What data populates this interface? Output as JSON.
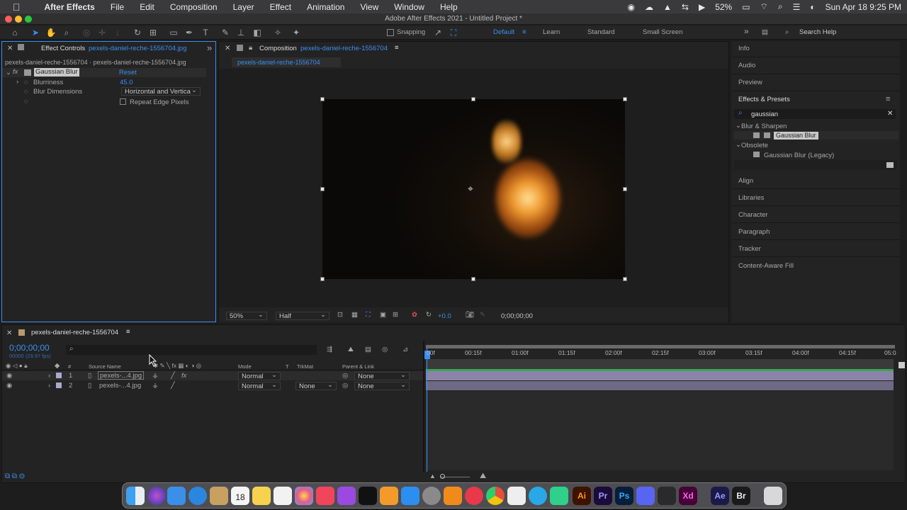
{
  "menubar": {
    "app": "After Effects",
    "items": [
      "File",
      "Edit",
      "Composition",
      "Layer",
      "Effect",
      "Animation",
      "View",
      "Window",
      "Help"
    ],
    "battery": "52%",
    "datetime": "Sun Apr 18  9:25 PM"
  },
  "window": {
    "title": "Adobe After Effects 2021 - Untitled Project *"
  },
  "toolbar": {
    "snapping": "Snapping",
    "workspaces": [
      "Default",
      "Learn",
      "Standard",
      "Small Screen"
    ],
    "search_help": "Search Help"
  },
  "effect_controls": {
    "tab": "Effect Controls",
    "file": "pexels-daniel-reche-1556704.jpg",
    "path": "pexels-daniel-reche-1556704 · pexels-daniel-reche-1556704.jpg",
    "effect": "Gaussian Blur",
    "reset": "Reset",
    "blurriness_label": "Blurriness",
    "blurriness_value": "45.0",
    "dimensions_label": "Blur Dimensions",
    "dimensions_value": "Horizontal and Vertica",
    "repeat_label": "Repeat Edge Pixels"
  },
  "composition": {
    "tab": "Composition",
    "name": "pexels-daniel-reche-1556704",
    "subtab": "pexels-daniel-reche-1556704",
    "zoom": "50%",
    "resolution": "Half",
    "exposure": "+0.0",
    "timecode": "0;00;00;00"
  },
  "right_panel": {
    "items_top": [
      "Info",
      "Audio",
      "Preview"
    ],
    "effects_title": "Effects & Presets",
    "search": "gaussian",
    "cat1": "Blur & Sharpen",
    "item1": "Gaussian Blur",
    "cat2": "Obsolete",
    "item2": "Gaussian Blur (Legacy)",
    "items_bottom": [
      "Align",
      "Libraries",
      "Character",
      "Paragraph",
      "Tracker",
      "Content-Aware Fill"
    ]
  },
  "timeline": {
    "tab": "pexels-daniel-reche-1556704",
    "timecode": "0;00;00;00",
    "fps": "00000 (29.97 fps)",
    "columns": {
      "num": "#",
      "source": "Source Name",
      "mode": "Mode",
      "t": "T",
      "trkmat": "TrkMat",
      "parent": "Parent & Link"
    },
    "layers": [
      {
        "num": "1",
        "name": "pexels-...4.jpg",
        "mode": "Normal",
        "trkmat": "",
        "parent": "None"
      },
      {
        "num": "2",
        "name": "pexels-...4.jpg",
        "mode": "Normal",
        "trkmat": "None",
        "parent": "None"
      }
    ],
    "ticks": [
      "00f",
      "00:15f",
      "01:00f",
      "01:15f",
      "02:00f",
      "02:15f",
      "03:00f",
      "03:15f",
      "04:00f",
      "04:15f",
      "05:0"
    ]
  },
  "dock": {
    "calendar_day": "18"
  }
}
